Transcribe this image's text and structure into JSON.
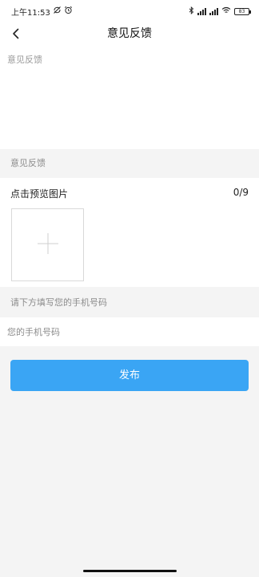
{
  "status_bar": {
    "time": "上午11:53",
    "left_icons": [
      "sync-off-icon",
      "alarm-icon"
    ],
    "right_icons": [
      "bluetooth-icon",
      "signal-icon",
      "signal-icon",
      "wifi-icon"
    ],
    "battery": "83"
  },
  "nav": {
    "title": "意见反馈",
    "back_icon": "chevron-left-icon"
  },
  "feedback": {
    "placeholder": "意见反馈"
  },
  "section_feedback_label": "意见反馈",
  "images": {
    "title": "点击预览图片",
    "count": "0/9",
    "add_icon": "plus-icon"
  },
  "section_phone_label": "请下方填写您的手机号码",
  "phone": {
    "placeholder": "您的手机号码"
  },
  "publish_label": "发布",
  "colors": {
    "accent": "#3aa5f4",
    "background": "#f4f4f4",
    "surface": "#ffffff",
    "muted_text": "#8c8c8c"
  }
}
